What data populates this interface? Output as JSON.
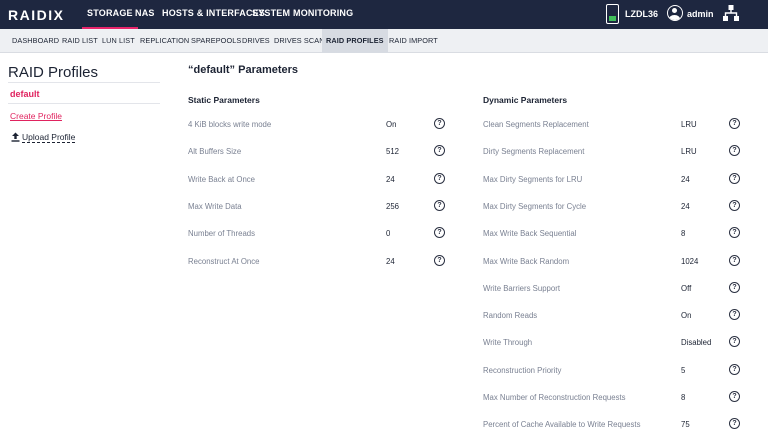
{
  "header": {
    "logo": "RAIDIX",
    "nav": [
      {
        "label": "STORAGE",
        "active": true
      },
      {
        "label": "NAS",
        "active": false
      },
      {
        "label": "HOSTS & INTERFACES",
        "active": false
      },
      {
        "label": "SYSTEM",
        "active": false
      },
      {
        "label": "MONITORING",
        "active": false
      }
    ],
    "device_name": "LZDL36",
    "user_name": "admin"
  },
  "subnav": [
    {
      "label": "DASHBOARD",
      "active": false
    },
    {
      "label": "RAID LIST",
      "active": false
    },
    {
      "label": "LUN LIST",
      "active": false
    },
    {
      "label": "REPLICATION",
      "active": false
    },
    {
      "label": "SPAREPOOLS",
      "active": false
    },
    {
      "label": "DRIVES",
      "active": false
    },
    {
      "label": "DRIVES SCAN",
      "active": false
    },
    {
      "label": "RAID PROFILES",
      "active": true
    },
    {
      "label": "RAID IMPORT",
      "active": false
    }
  ],
  "sidebar": {
    "title": "RAID Profiles",
    "active_profile": "default",
    "create_label": "Create Profile",
    "upload_label": "Upload Profile"
  },
  "main": {
    "title": "“default” Parameters",
    "static": {
      "title": "Static Parameters",
      "params": [
        {
          "label": "4 KiB blocks write mode",
          "value": "On"
        },
        {
          "label": "Alt Buffers Size",
          "value": "512"
        },
        {
          "label": "Write Back at Once",
          "value": "24"
        },
        {
          "label": "Max Write Data",
          "value": "256"
        },
        {
          "label": "Number of Threads",
          "value": "0"
        },
        {
          "label": "Reconstruct At Once",
          "value": "24"
        }
      ]
    },
    "dynamic": {
      "title": "Dynamic Parameters",
      "params": [
        {
          "label": "Clean Segments Replacement",
          "value": "LRU"
        },
        {
          "label": "Dirty Segments Replacement",
          "value": "LRU"
        },
        {
          "label": "Max Dirty Segments for LRU",
          "value": "24"
        },
        {
          "label": "Max Dirty Segments for Cycle",
          "value": "24"
        },
        {
          "label": "Max Write Back Sequential",
          "value": "8"
        },
        {
          "label": "Max Write Back Random",
          "value": "1024"
        },
        {
          "label": "Write Barriers Support",
          "value": "Off"
        },
        {
          "label": "Random Reads",
          "value": "On"
        },
        {
          "label": "Write Through",
          "value": "Disabled"
        },
        {
          "label": "Reconstruction Priority",
          "value": "5"
        },
        {
          "label": "Max Number of Reconstruction Requests",
          "value": "8"
        },
        {
          "label": "Percent of Cache Available to Write Requests",
          "value": "75"
        }
      ]
    },
    "help_glyph": "?"
  },
  "colors": {
    "header_bg": "#1e2740",
    "accent": "#e8256b",
    "subnav_bg": "#eef0f3"
  },
  "icons": {
    "device": "storage-device-icon",
    "user": "user-circle-icon",
    "network": "network-topology-icon",
    "upload": "upload-arrow-icon",
    "help": "help-circle-icon"
  }
}
